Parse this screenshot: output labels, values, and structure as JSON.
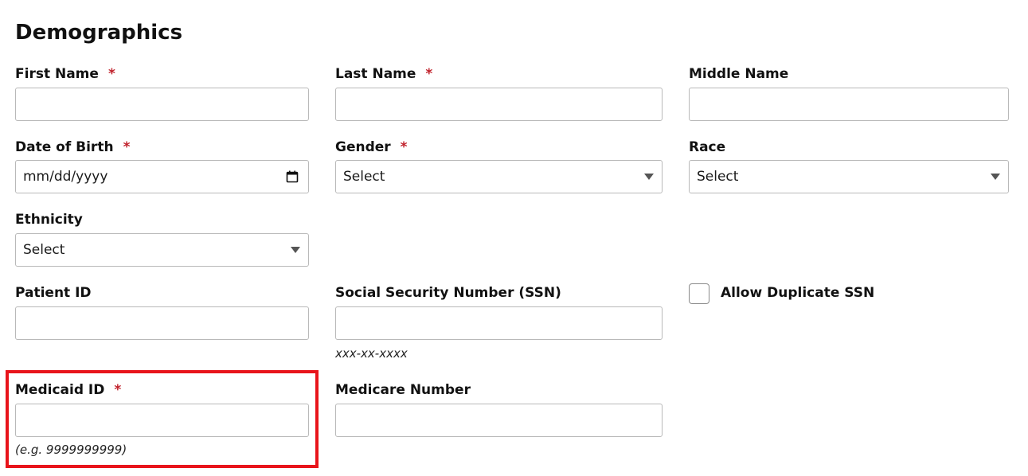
{
  "page": {
    "title": "Demographics"
  },
  "fields": {
    "first_name": {
      "label": "First Name",
      "required_mark": "*",
      "value": ""
    },
    "last_name": {
      "label": "Last Name",
      "required_mark": "*",
      "value": ""
    },
    "middle_name": {
      "label": "Middle Name",
      "value": ""
    },
    "date_of_birth": {
      "label": "Date of Birth",
      "required_mark": "*",
      "placeholder": "mm/dd/yyyy"
    },
    "gender": {
      "label": "Gender",
      "required_mark": "*",
      "selected": "Select"
    },
    "race": {
      "label": "Race",
      "selected": "Select"
    },
    "ethnicity": {
      "label": "Ethnicity",
      "selected": "Select"
    },
    "patient_id": {
      "label": "Patient ID",
      "value": ""
    },
    "ssn": {
      "label": "Social Security Number (SSN)",
      "hint": "xxx-xx-xxxx",
      "value": ""
    },
    "allow_duplicate_ssn": {
      "label": "Allow Duplicate SSN",
      "checked": false
    },
    "medicaid_id": {
      "label": "Medicaid ID",
      "required_mark": "*",
      "hint": "(e.g. 9999999999)",
      "value": ""
    },
    "medicare_number": {
      "label": "Medicare Number",
      "value": ""
    }
  },
  "colors": {
    "required": "#c0202a",
    "highlight": "#e8141b",
    "border": "#b9b9b9"
  },
  "icons": {
    "date_picker": "calendar-icon",
    "select_caret": "chevron-down-icon"
  }
}
